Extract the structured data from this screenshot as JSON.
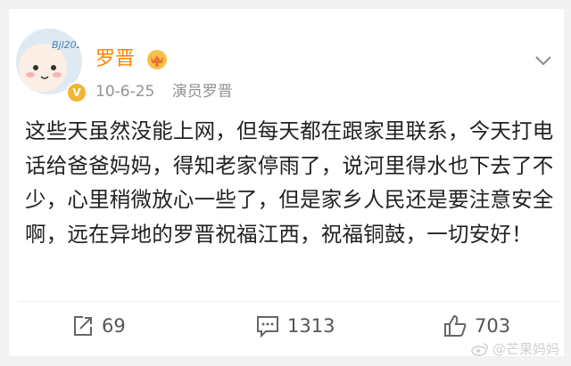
{
  "post": {
    "author": "罗晋",
    "date": "10-6-25",
    "source": "演员罗晋",
    "avatar_text": "Bjl2020",
    "verified_mark": "V",
    "text": "这些天虽然没能上网，但每天都在跟家里联系，今天打电话给爸爸妈妈，得知老家停雨了，说河里得水也下去了不少，心里稍微放心一些了，但是家乡人民还是要注意安全啊，远在异地的罗晋祝福江西，祝福铜鼓，一切安好！"
  },
  "actions": {
    "reposts": "69",
    "comments": "1313",
    "likes": "703"
  },
  "watermark": "@芒果妈妈",
  "colors": {
    "username": "#ff8200",
    "meta": "#939393",
    "text": "#222222",
    "badge": "#f2b632"
  },
  "icons": [
    "crown-icon",
    "chevron-down-icon",
    "repost-icon",
    "comment-icon",
    "like-icon",
    "weibo-icon"
  ]
}
